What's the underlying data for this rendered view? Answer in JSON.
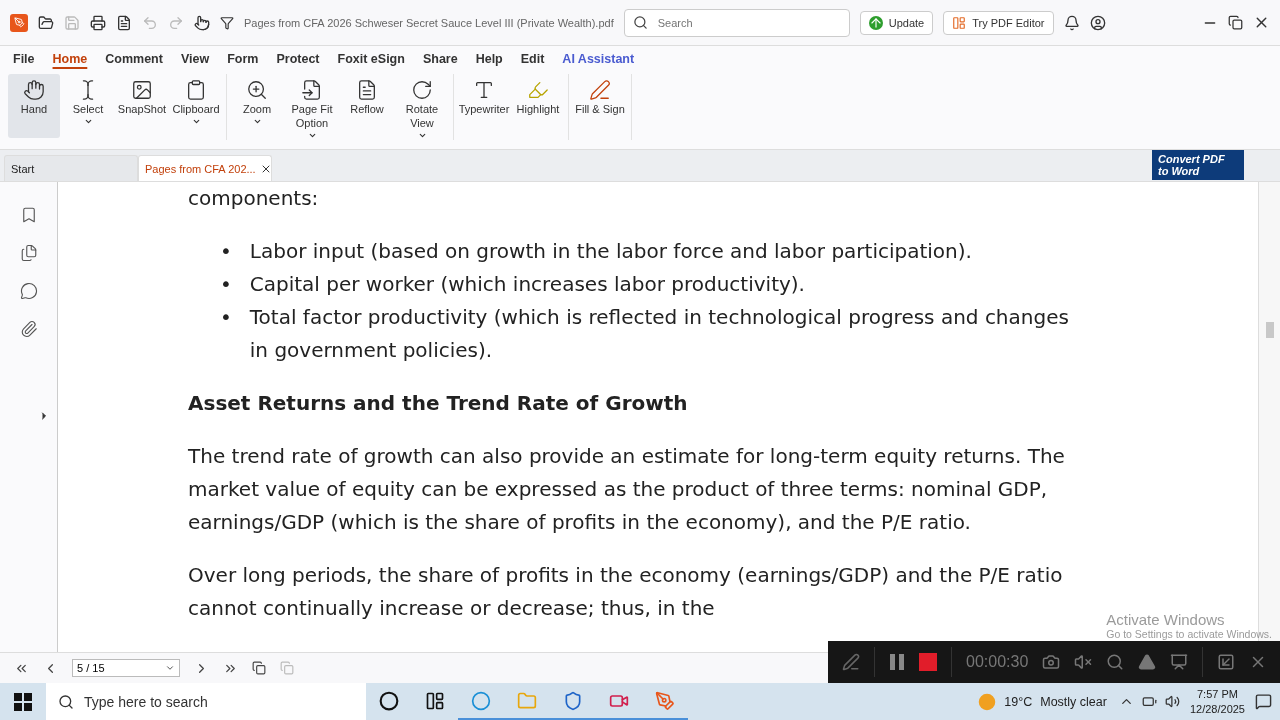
{
  "title_bar": {
    "file_title": "Pages from CFA 2026 Schweser Secret Sauce Level III (Private Wealth).pdf",
    "search": {
      "placeholder": "Search"
    },
    "buttons": [
      {
        "label": "Update",
        "kind": "update"
      },
      {
        "label": "Try PDF Editor",
        "kind": "editor"
      }
    ]
  },
  "menu_tabs": [
    {
      "label": "File",
      "selected": false,
      "kind": "plain"
    },
    {
      "label": "Home",
      "selected": true,
      "kind": "plain"
    },
    {
      "label": "Comment",
      "selected": false,
      "kind": "plain"
    },
    {
      "label": "View",
      "selected": false,
      "kind": "plain"
    },
    {
      "label": "Form",
      "selected": false,
      "kind": "plain"
    },
    {
      "label": "Protect",
      "selected": false,
      "kind": "plain"
    },
    {
      "label": "Foxit eSign",
      "selected": false,
      "kind": "plain"
    },
    {
      "label": "Share",
      "selected": false,
      "kind": "plain"
    },
    {
      "label": "Help",
      "selected": false,
      "kind": "plain"
    },
    {
      "label": "Edit",
      "selected": false,
      "kind": "plain"
    },
    {
      "label": "AI Assistant",
      "selected": false,
      "kind": "ai"
    }
  ],
  "ribbon": [
    [
      {
        "label": "Hand",
        "selected": true,
        "dropdown": false
      },
      {
        "label": "Select",
        "selected": false,
        "dropdown": true
      },
      {
        "label": "SnapShot",
        "selected": false,
        "dropdown": false
      },
      {
        "label": "Clipboard",
        "selected": false,
        "dropdown": true
      }
    ],
    [
      {
        "label": "Zoom",
        "selected": false,
        "dropdown": true
      },
      {
        "label": "Page Fit Option",
        "selected": false,
        "dropdown": true
      },
      {
        "label": "Reflow",
        "selected": false,
        "dropdown": false
      },
      {
        "label": "Rotate View",
        "selected": false,
        "dropdown": true
      }
    ],
    [
      {
        "label": "Typewriter",
        "selected": false,
        "dropdown": false
      },
      {
        "label": "Highlight",
        "selected": false,
        "dropdown": false
      }
    ],
    [
      {
        "label": "Fill & Sign",
        "selected": false,
        "dropdown": false
      }
    ]
  ],
  "doc_tabs": [
    {
      "label": "Start",
      "selected": false,
      "closable": false
    },
    {
      "label": "Pages from CFA 202...",
      "selected": true,
      "closable": true
    }
  ],
  "banner": {
    "text": "Convert PDF to Word"
  },
  "sidebar_icons": [
    {
      "kind": "bookmark"
    },
    {
      "kind": "pages"
    },
    {
      "kind": "comment"
    },
    {
      "kind": "attachment"
    }
  ],
  "document": [
    {
      "kind": "text",
      "text": "components:"
    },
    {
      "kind": "bullets",
      "marker": "•",
      "items": [
        "Labor input (based on growth in the labor force and labor participation).",
        "Capital per worker (which increases labor productivity).",
        "Total factor productivity (which is reflected in technological progress and changes in government policies)."
      ]
    },
    {
      "kind": "heading",
      "text": "Asset Returns and the Trend Rate of Growth"
    },
    {
      "kind": "text",
      "text": "The trend rate of growth can also provide an estimate for long-term equity returns. The market value of equity can be expressed as the product of three terms: nominal GDP, earnings/GDP (which is the share of profits in the economy), and the P/E ratio."
    },
    {
      "kind": "text",
      "text": "Over long periods, the share of profits in the economy (earnings/GDP) and the P/E ratio cannot continually increase or decrease; thus, in the"
    }
  ],
  "page_nav": {
    "page": "5 / 15"
  },
  "recorder": {
    "time": "00:00:30"
  },
  "windows_notice": {
    "title": "Activate Windows",
    "subtitle": "Go to Settings to activate Windows."
  },
  "taskbar": {
    "search_placeholder": "Type here to search",
    "apps": [
      {
        "kind": "cortana"
      },
      {
        "kind": "taskview"
      },
      {
        "kind": "edge"
      },
      {
        "kind": "explorer"
      },
      {
        "kind": "shield"
      },
      {
        "kind": "recorder"
      },
      {
        "kind": "foxit"
      }
    ],
    "temperature": "19°C",
    "condition": "Mostly clear",
    "time": "7:57 PM",
    "date": "12/28/2025"
  }
}
